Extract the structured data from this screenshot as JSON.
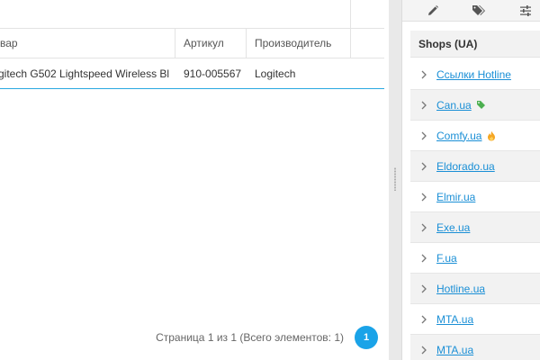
{
  "grid": {
    "columns": [
      {
        "label": "вар"
      },
      {
        "label": "Артикул"
      },
      {
        "label": "Производитель"
      }
    ],
    "rows": [
      {
        "product": "gitech G502 Lightspeed Wireless Bl...",
        "sku": "910-005567",
        "manufacturer": "Logitech"
      }
    ]
  },
  "pager": {
    "info": "Страница 1 из 1 (Всего элементов: 1)",
    "current_page": "1"
  },
  "toolbar": {
    "icons": [
      "pencil-icon",
      "tags-icon",
      "sliders-icon"
    ]
  },
  "shops_panel": {
    "title": "Shops (UA)",
    "items": [
      {
        "label": "Ссылки Hotline",
        "badge": null
      },
      {
        "label": "Can.ua",
        "badge": "tag-icon",
        "badge_color": "#4caf50"
      },
      {
        "label": "Comfy.ua",
        "badge": "fire-icon",
        "badge_color": "#f5a623"
      },
      {
        "label": "Eldorado.ua",
        "badge": null
      },
      {
        "label": "Elmir.ua",
        "badge": null
      },
      {
        "label": "Exe.ua",
        "badge": null
      },
      {
        "label": "F.ua",
        "badge": null
      },
      {
        "label": "Hotline.ua",
        "badge": null
      },
      {
        "label": "MTA.ua",
        "badge": null
      },
      {
        "label": "MTA.ua",
        "badge": null
      }
    ]
  },
  "colors": {
    "accent": "#1aa3e8",
    "link": "#1a8fd6",
    "row_highlight": "#29a8e0"
  }
}
